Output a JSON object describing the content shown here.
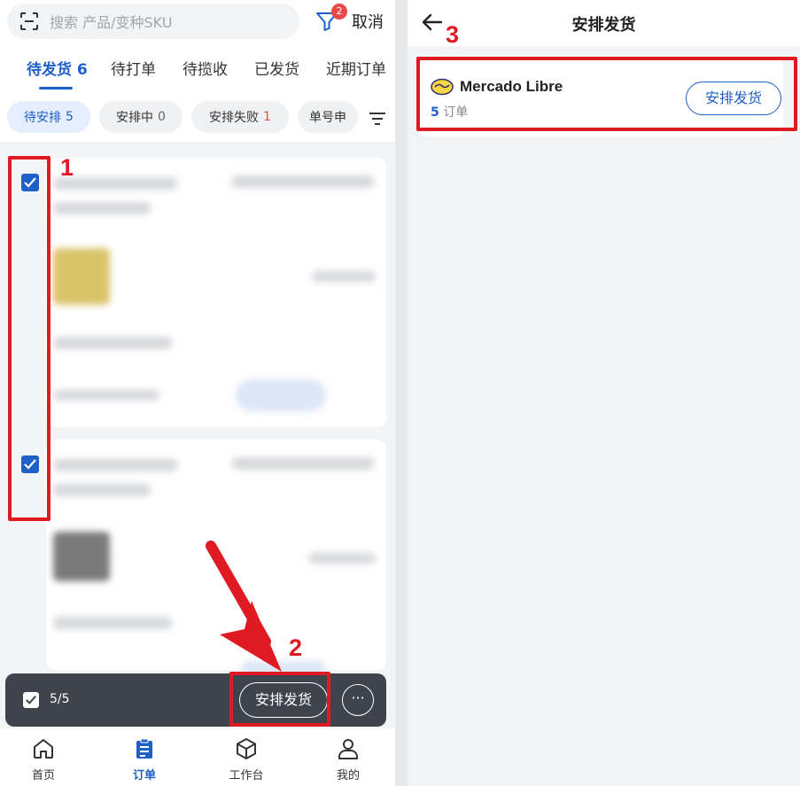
{
  "search": {
    "placeholder": "搜索 产品/变种SKU"
  },
  "header": {
    "filter_badge": "2",
    "cancel_label": "取消"
  },
  "tabs": [
    {
      "label": "待发货 6",
      "active": true
    },
    {
      "label": "待打单"
    },
    {
      "label": "待揽收"
    },
    {
      "label": "已发货"
    },
    {
      "label": "近期订单"
    }
  ],
  "chips": [
    {
      "label": "待安排",
      "count": "5",
      "active": true
    },
    {
      "label": "安排中",
      "count": "0"
    },
    {
      "label": "安排失败",
      "count": "1"
    },
    {
      "label": "单号申"
    }
  ],
  "action_bar": {
    "count": "5/5",
    "arrange_label": "安排发货"
  },
  "bottom_nav": [
    {
      "label": "首页",
      "icon": "home-icon"
    },
    {
      "label": "订单",
      "icon": "order-icon",
      "active": true
    },
    {
      "label": "工作台",
      "icon": "cube-icon"
    },
    {
      "label": "我的",
      "icon": "user-icon"
    }
  ],
  "annotations": {
    "n1": "1",
    "n2": "2",
    "n3": "3"
  },
  "right": {
    "title": "安排发货",
    "platform_name": "Mercado Libre",
    "order_count": "5",
    "order_unit": "订单",
    "arrange_label": "安排发货"
  },
  "colors": {
    "accent": "#1f5fc8",
    "annotation": "#e01a22",
    "action_bar": "#3e434c"
  }
}
